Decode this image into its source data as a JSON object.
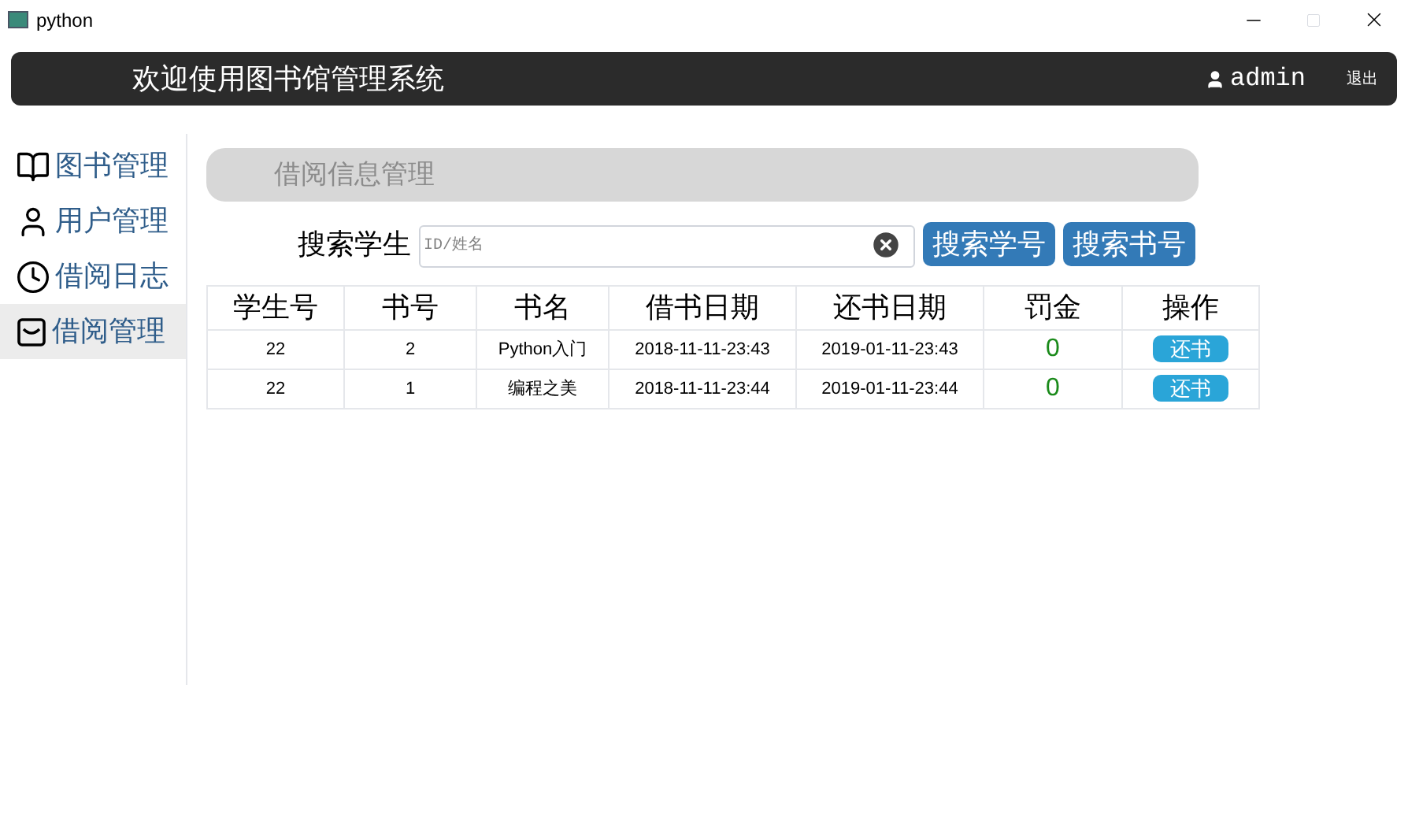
{
  "window": {
    "title": "python"
  },
  "header": {
    "title": "欢迎使用图书馆管理系统",
    "user": "admin",
    "logout": "退出"
  },
  "sidebar": {
    "items": [
      {
        "label": "图书管理",
        "kind": "book",
        "selected": false
      },
      {
        "label": "用户管理",
        "kind": "user",
        "selected": false
      },
      {
        "label": "借阅日志",
        "kind": "clock",
        "selected": false
      },
      {
        "label": "借阅管理",
        "kind": "tray",
        "selected": true
      }
    ]
  },
  "section_title": "借阅信息管理",
  "search": {
    "label": "搜索学生",
    "placeholder": "ID/姓名",
    "buttons": [
      "搜索学号",
      "搜索书号"
    ]
  },
  "table": {
    "columns": [
      "学生号",
      "书号",
      "书名",
      "借书日期",
      "还书日期",
      "罚金",
      "操作"
    ],
    "rows": [
      {
        "student": "22",
        "book_id": "2",
        "book_name": "Python入门",
        "borrow_date": "2018-11-11-23:43",
        "return_date": "2019-01-11-23:43",
        "fine": "0",
        "action": "还书"
      },
      {
        "student": "22",
        "book_id": "1",
        "book_name": "编程之美",
        "borrow_date": "2018-11-11-23:44",
        "return_date": "2019-01-11-23:44",
        "fine": "0",
        "action": "还书"
      }
    ]
  }
}
